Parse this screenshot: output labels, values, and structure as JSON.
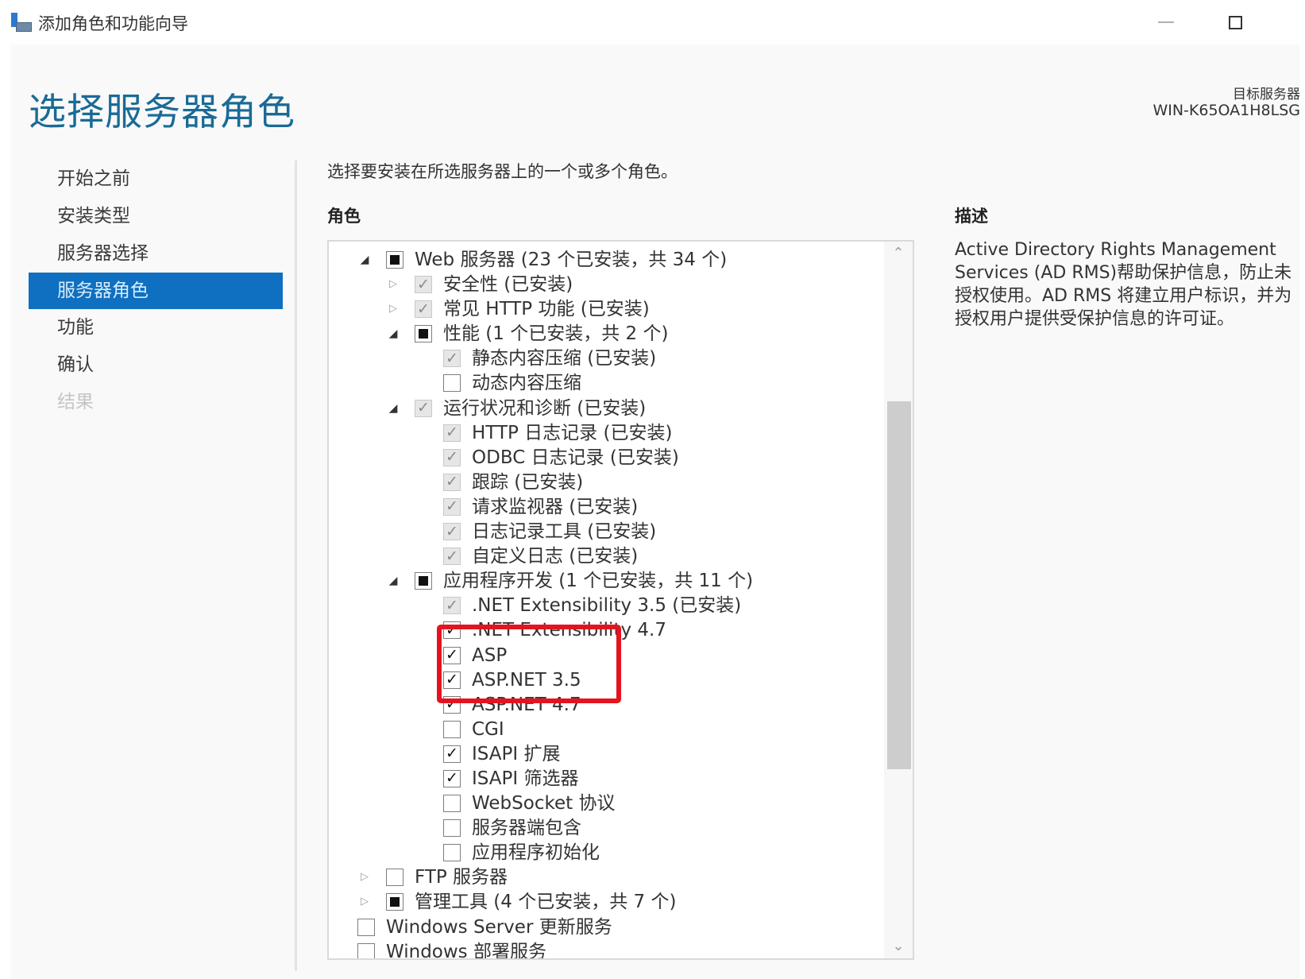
{
  "window": {
    "title": "添加角色和功能向导",
    "icon": "server-manager-icon",
    "minimize_icon": "minimize-icon",
    "maximize_icon": "maximize-icon"
  },
  "header": {
    "page_title": "选择服务器角色",
    "target_server_label": "目标服务器",
    "target_server_name": "WIN-K65OA1H8LSG"
  },
  "nav": {
    "items": [
      {
        "label": "开始之前",
        "state": "normal"
      },
      {
        "label": "安装类型",
        "state": "normal"
      },
      {
        "label": "服务器选择",
        "state": "normal"
      },
      {
        "label": "服务器角色",
        "state": "selected"
      },
      {
        "label": "功能",
        "state": "normal"
      },
      {
        "label": "确认",
        "state": "normal"
      },
      {
        "label": "结果",
        "state": "disabled"
      }
    ]
  },
  "main": {
    "instruction": "选择要安装在所选服务器上的一个或多个角色。",
    "roles_heading": "角色",
    "description_heading": "描述",
    "description_text": "Active Directory Rights Management Services (AD RMS)帮助保护信息，防止未授权使用。AD RMS 将建立用户标识，并为授权用户提供受保护信息的许可证。",
    "highlight_color": "#e3141f",
    "scroll_position": 0.45,
    "scroll_visible_fraction": 0.55,
    "roles": [
      {
        "level": 1,
        "expander": "open",
        "state": "partial",
        "label": "Web 服务器 (23 个已安装，共 34 个)"
      },
      {
        "level": 2,
        "expander": "closed",
        "state": "installed",
        "label": "安全性 (已安装)"
      },
      {
        "level": 2,
        "expander": "closed",
        "state": "installed",
        "label": "常见 HTTP 功能 (已安装)"
      },
      {
        "level": 2,
        "expander": "open",
        "state": "partial",
        "label": "性能 (1 个已安装，共 2 个)"
      },
      {
        "level": 3,
        "expander": "none",
        "state": "installed",
        "label": "静态内容压缩 (已安装)"
      },
      {
        "level": 3,
        "expander": "none",
        "state": "unchecked",
        "label": "动态内容压缩"
      },
      {
        "level": 2,
        "expander": "open",
        "state": "installed",
        "label": "运行状况和诊断 (已安装)"
      },
      {
        "level": 3,
        "expander": "none",
        "state": "installed",
        "label": "HTTP 日志记录 (已安装)"
      },
      {
        "level": 3,
        "expander": "none",
        "state": "installed",
        "label": "ODBC 日志记录 (已安装)"
      },
      {
        "level": 3,
        "expander": "none",
        "state": "installed",
        "label": "跟踪 (已安装)"
      },
      {
        "level": 3,
        "expander": "none",
        "state": "installed",
        "label": "请求监视器 (已安装)"
      },
      {
        "level": 3,
        "expander": "none",
        "state": "installed",
        "label": "日志记录工具 (已安装)"
      },
      {
        "level": 3,
        "expander": "none",
        "state": "installed",
        "label": "自定义日志 (已安装)"
      },
      {
        "level": 2,
        "expander": "open",
        "state": "partial",
        "label": "应用程序开发 (1 个已安装，共 11 个)"
      },
      {
        "level": 3,
        "expander": "none",
        "state": "installed",
        "label": ".NET Extensibility 3.5 (已安装)"
      },
      {
        "level": 3,
        "expander": "none",
        "state": "checked",
        "label": ".NET Extensibility 4.7"
      },
      {
        "level": 3,
        "expander": "none",
        "state": "checked",
        "label": "ASP"
      },
      {
        "level": 3,
        "expander": "none",
        "state": "checked",
        "label": "ASP.NET 3.5"
      },
      {
        "level": 3,
        "expander": "none",
        "state": "checked",
        "label": "ASP.NET 4.7"
      },
      {
        "level": 3,
        "expander": "none",
        "state": "unchecked",
        "label": "CGI"
      },
      {
        "level": 3,
        "expander": "none",
        "state": "checked",
        "label": "ISAPI 扩展"
      },
      {
        "level": 3,
        "expander": "none",
        "state": "checked",
        "label": "ISAPI 筛选器"
      },
      {
        "level": 3,
        "expander": "none",
        "state": "unchecked",
        "label": "WebSocket 协议"
      },
      {
        "level": 3,
        "expander": "none",
        "state": "unchecked",
        "label": "服务器端包含"
      },
      {
        "level": 3,
        "expander": "none",
        "state": "unchecked",
        "label": "应用程序初始化"
      },
      {
        "level": 1,
        "expander": "closed",
        "state": "unchecked",
        "label": "FTP 服务器"
      },
      {
        "level": 1,
        "expander": "closed",
        "state": "partial",
        "label": "管理工具 (4 个已安装，共 7 个)"
      },
      {
        "level": 0,
        "expander": "none",
        "state": "unchecked",
        "label": "Windows Server 更新服务"
      },
      {
        "level": 0,
        "expander": "none",
        "state": "unchecked",
        "label": "Windows 部署服务"
      }
    ]
  }
}
